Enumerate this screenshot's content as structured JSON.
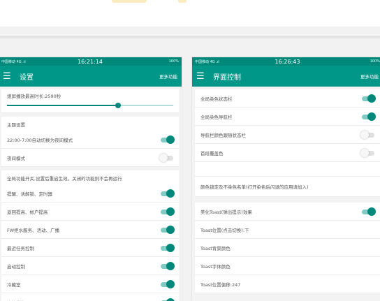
{
  "colors": {
    "status": "#00897b",
    "appbar": "#009688",
    "toggle_on": "#00897b"
  },
  "left": {
    "status": {
      "left": "中国移动 4G .ıl",
      "time": "16:21:14",
      "right": "100%"
    },
    "appbar": {
      "title": "设置",
      "more": "更多功能"
    },
    "slider": {
      "label": "熄屏播放最高时长:2590秒",
      "fraction": 0.67
    },
    "section1": "主题设置",
    "items1": [
      {
        "label": "22:00-7:00自动切换为夜间模式",
        "on": true
      },
      {
        "label": "夜间模式",
        "on": false
      }
    ],
    "section2": "全局功能开关,设置后重启生效。关闭的功能则不会再运行",
    "items2": [
      {
        "label": "提醒、诱解锁、定时器",
        "on": true
      },
      {
        "label": "返回提高、帐户提高",
        "on": true
      },
      {
        "label": "FW拒水服务、活动、广播",
        "on": true
      },
      {
        "label": "最近任务控制",
        "on": true
      },
      {
        "label": "启动控制",
        "on": true
      },
      {
        "label": "冷藏室",
        "on": true
      },
      {
        "label": "电池优化",
        "on": true
      }
    ]
  },
  "right": {
    "status": {
      "left": "中国移动 4G .ıl",
      "time": "16:26:43",
      "right": "100%"
    },
    "appbar": {
      "title": "界面控制",
      "more": "更多功能"
    },
    "items1": [
      {
        "label": "全局染色状态栏",
        "on": true
      },
      {
        "label": "全局染色导航栏",
        "on": true
      },
      {
        "label": "导航栏颜色跟随状态栏",
        "on": false
      },
      {
        "label": "首段覆盖色",
        "on": false
      }
    ],
    "whitelist": "颜色锁定及不染色名单(打开染色后闪退的应用请加入)",
    "items2": [
      {
        "label": "美化Toast(弹出提示)效果",
        "on": true
      }
    ],
    "toast_rows": [
      "Toast位置(点击切换):下",
      "Toast背景颜色",
      "Toast字体颜色",
      "Toast位置偏移:247"
    ]
  }
}
